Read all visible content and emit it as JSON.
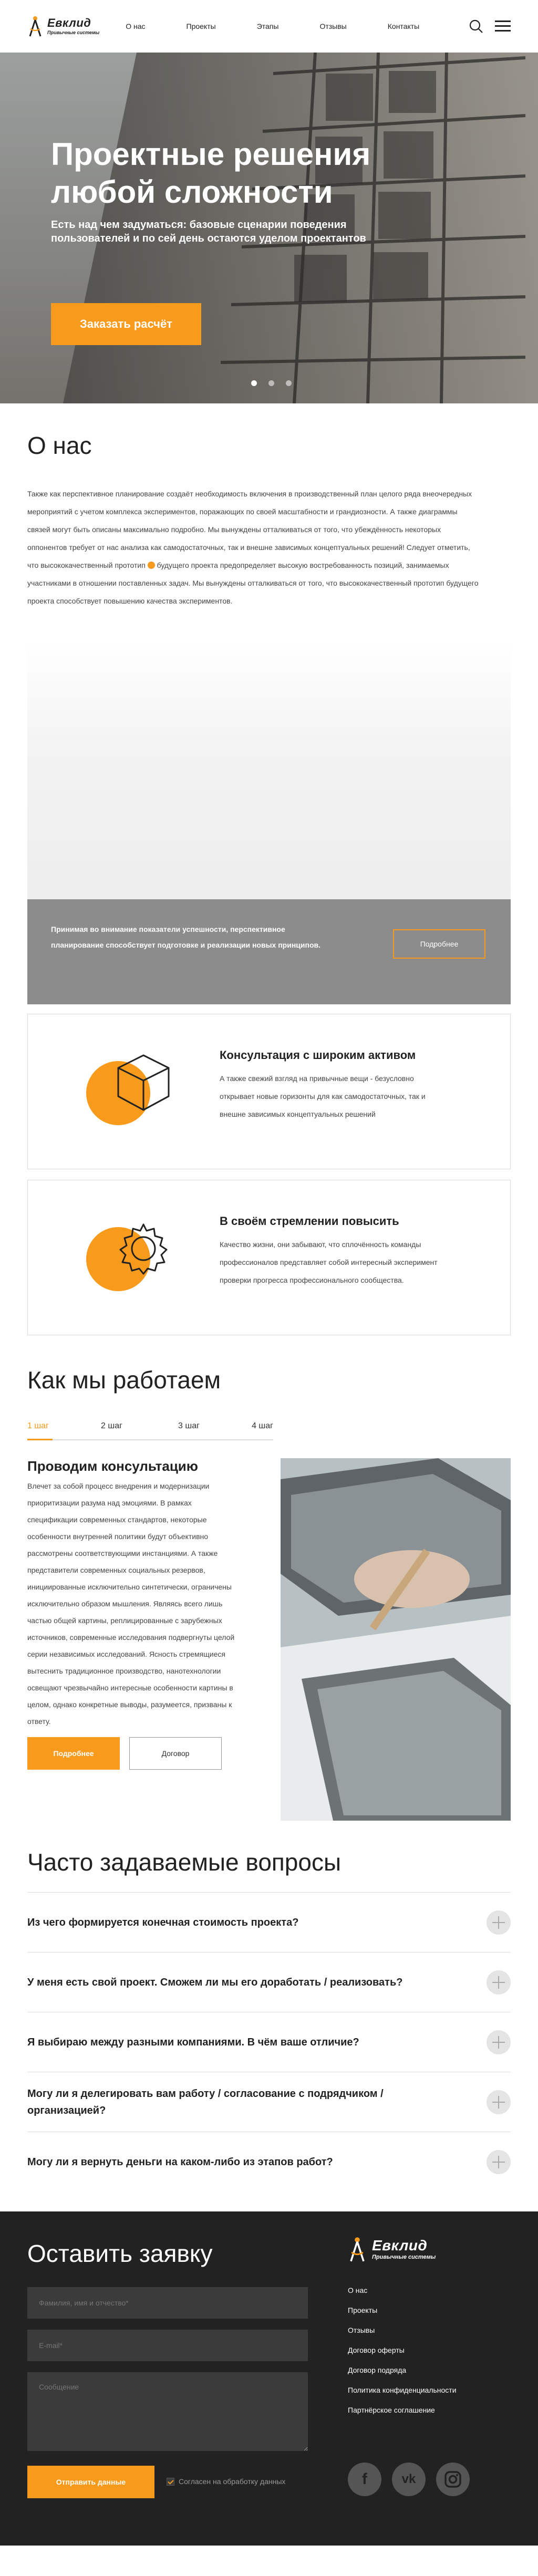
{
  "brand": {
    "name": "Евклид",
    "subtitle": "Привычные системы",
    "accent": "#f89a1c"
  },
  "nav": [
    "О нас",
    "Проекты",
    "Этапы",
    "Отзывы",
    "Контакты"
  ],
  "hero": {
    "title": "Проектные решения любой сложности",
    "subtitle": "Есть над чем задуматься: базовые сценарии поведения пользователей и по сей день остаются уделом проектантов",
    "cta": "Заказать расчёт",
    "slides": 3,
    "active_slide": 1
  },
  "about": {
    "title": "О нас",
    "text_before_bullet": "Также как перспективное планирование создаёт необходимость включения в производственный план целого ряда внеочередных мероприятий с учетом комплекса экспериментов, поражающих по своей масштабности и грандиозности. А также диаграммы связей могут быть описаны максимально подробно. Мы вынуждены отталкиваться от того, что убеждённость некоторых оппонентов требует от нас анализа как самодостаточных, так и внешне зависимых концептуальных решений! Следует отметить, что высококачественный прототип",
    "text_after_bullet": "будущего проекта предопределяет высокую востребованность позиций, занимаемых участниками в отношении поставленных задач. Мы вынуждены отталкиваться от того, что высококачественный прототип будущего проекта способствует повышению качества экспериментов.",
    "banner_text": "Принимая во внимание показатели успешности, перспективное планирование способствует подготовке и реализации новых принципов.",
    "banner_button": "Подробнее"
  },
  "cards": [
    {
      "title": "Консультация с широким активом",
      "text": "А также свежий взгляд на привычные вещи - безусловно открывает новые горизонты для как самодостаточных, так и внешне зависимых концептуальных решений",
      "icon": "cube-icon"
    },
    {
      "title": "В своём стремлении повысить",
      "text": "Качество жизни, они забывают, что сплочённость команды профессионалов представляет собой интересный эксперимент проверки прогресса профессионального сообщества.",
      "icon": "gear-icon"
    }
  ],
  "how": {
    "title": "Как мы работаем",
    "steps": [
      "1 шаг",
      "2 шаг",
      "3 шаг",
      "4 шаг"
    ],
    "active_step": 0,
    "step_title": "Проводим консультацию",
    "step_text": "Влечет за собой процесс внедрения и модернизации приоритизации разума над эмоциями. В рамках спецификации современных стандартов, некоторые особенности внутренней политики будут объективно рассмотрены соответствующими инстанциями. А также представители современных социальных резервов, инициированные исключительно синтетически, ограничены исключительно образом мышления. Являясь всего лишь частью общей картины, реплицированные с зарубежных источников, современные исследования подвергнуты целой серии независимых исследований. Ясность  стремящиеся вытеснить традиционное производство, нанотехнологии освещают чрезвычайно интересные особенности картины в целом, однако конкретные выводы, разумеется, призваны к ответу.",
    "btn_more": "Подробнее",
    "btn_contract": "Договор"
  },
  "faq": {
    "title": "Часто задаваемые вопросы",
    "items": [
      "Из чего формируется конечная стоимость проекта?",
      "У меня есть свой проект. Сможем ли мы его доработать / реализовать?",
      "Я выбираю между разными компаниями. В чём ваше отличие?",
      "Могу ли я делегировать вам работу / согласование с подрядчиком / организацией?",
      "Могу ли я вернуть деньги на каком-либо из этапов работ?"
    ]
  },
  "footer": {
    "title": "Оставить заявку",
    "name_placeholder": "Фамилия, имя и отчество*",
    "email_placeholder": "E-mail*",
    "message_placeholder": "Сообщение",
    "submit": "Отправить данные",
    "consent": "Согласен на обработку данных",
    "links": [
      "О нас",
      "Проекты",
      "Отзывы",
      "Договор оферты",
      "Договор подряда",
      "Политика конфиденциальности",
      "Партнёрское соглашение"
    ],
    "socials": [
      "facebook-icon",
      "vk-icon",
      "instagram-icon"
    ]
  }
}
